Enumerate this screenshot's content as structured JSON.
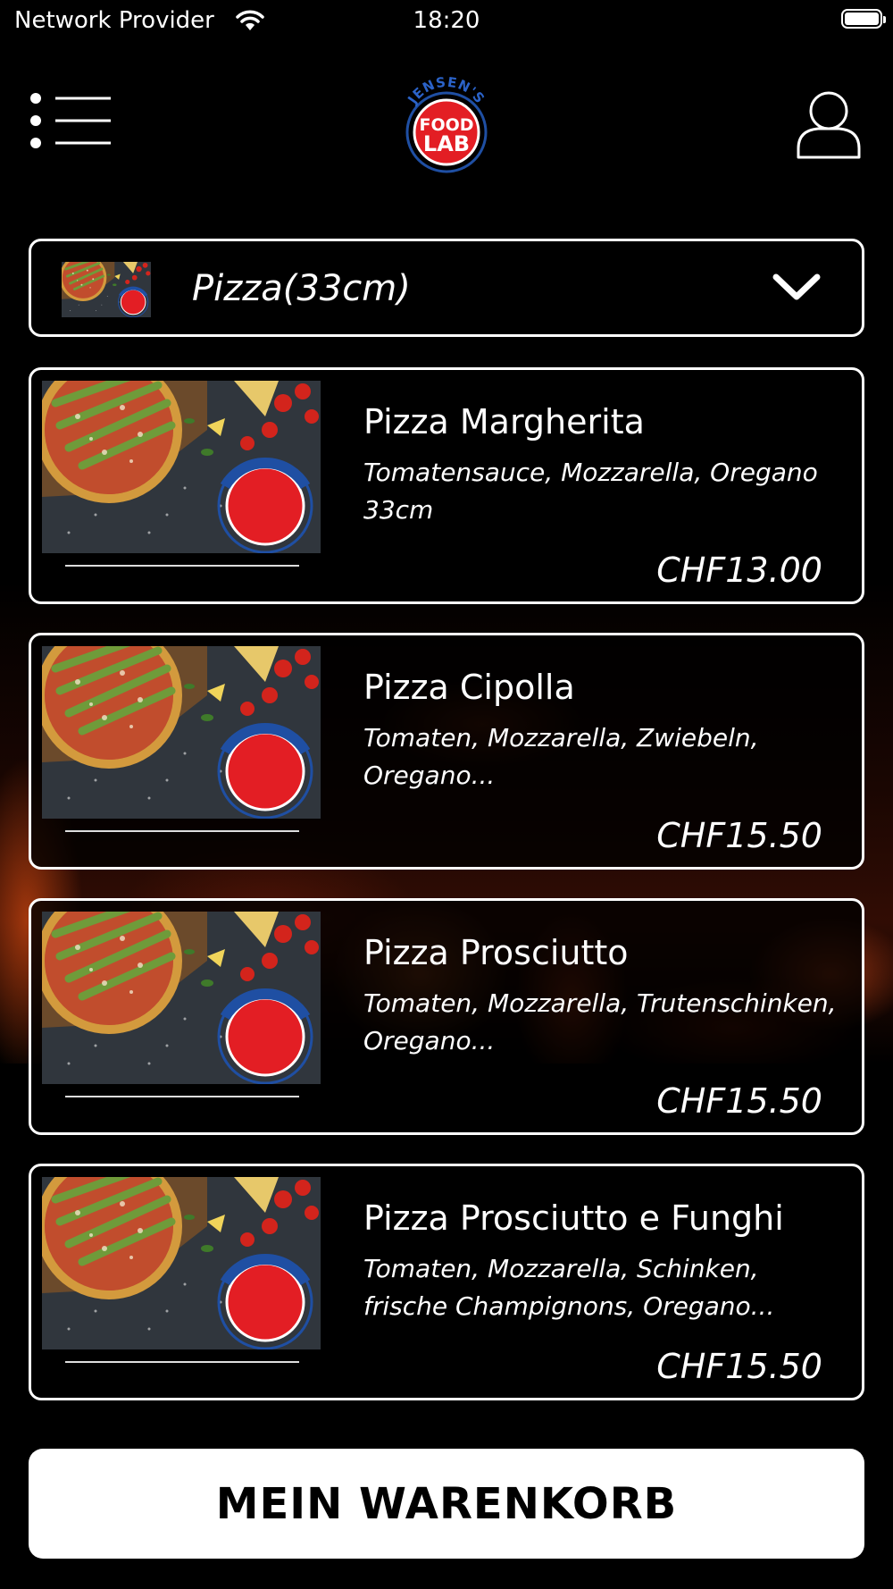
{
  "status_bar": {
    "carrier": "Network Provider",
    "time": "18:20",
    "icons": [
      "wifi-icon",
      "battery-icon"
    ]
  },
  "nav": {
    "menu_icon": "list-menu-icon",
    "account_icon": "user-icon",
    "logo": {
      "arc_text": "JENSEN'S",
      "line1": "FOOD",
      "line2": "LAB",
      "colors": {
        "red": "#e31e24",
        "blue": "#1f4fa3",
        "white": "#ffffff"
      }
    }
  },
  "category": {
    "selected": "Pizza(33cm)",
    "icon": "chevron-down-icon"
  },
  "products": [
    {
      "name": "Pizza Margherita",
      "description": "Tomatensauce, Mozzarella, Oregano 33cm",
      "price": "CHF13.00"
    },
    {
      "name": "Pizza Cipolla",
      "description": "Tomaten, Mozzarella, Zwiebeln, Oregano...",
      "price": "CHF15.50"
    },
    {
      "name": "Pizza Prosciutto",
      "description": "Tomaten, Mozzarella, Trutenschinken, Oregano...",
      "price": "CHF15.50"
    },
    {
      "name": "Pizza Prosciutto e Funghi",
      "description": "Tomaten, Mozzarella, Schinken, frische Champignons, Oregano...",
      "price": "CHF15.50"
    }
  ],
  "cart": {
    "label": "MEIN WARENKORB"
  },
  "theme": {
    "background": "#000000",
    "text": "#ffffff",
    "card_border": "#ffffff",
    "button_background": "#ffffff",
    "button_text": "#000000"
  }
}
